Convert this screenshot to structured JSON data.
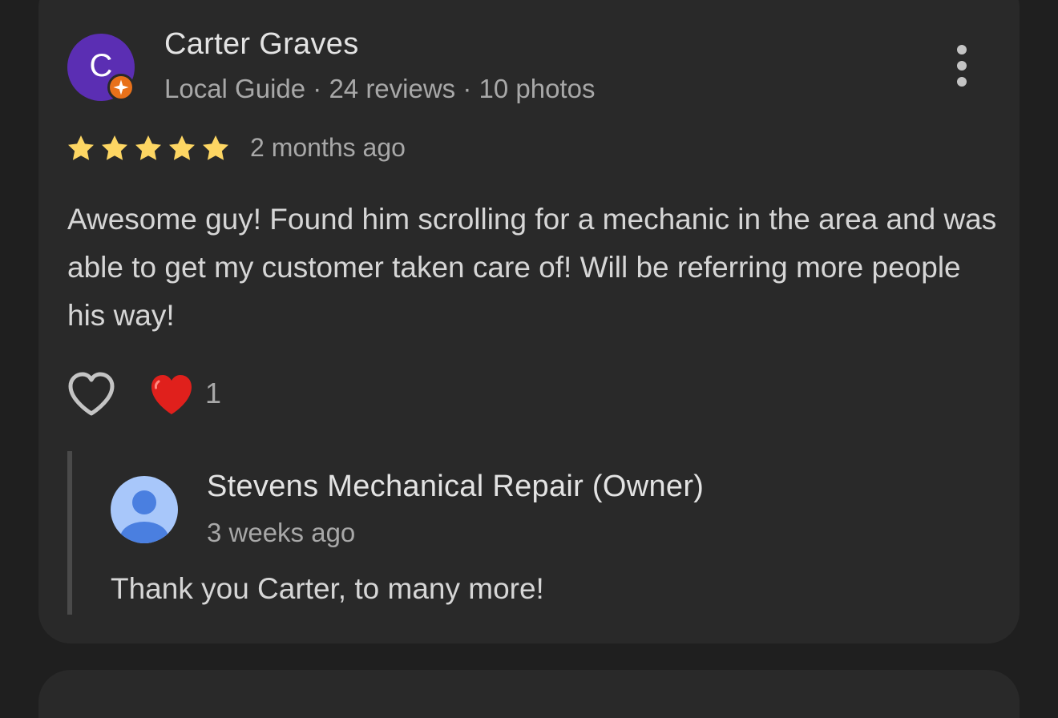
{
  "review": {
    "reviewer": {
      "initial": "C",
      "name": "Carter Graves",
      "meta": "Local Guide · 24 reviews · 10 photos",
      "avatar_color": "#5b2eb3",
      "badge_icon": "local-guide-star-icon",
      "badge_color": "#e8711a"
    },
    "rating": {
      "value": 5,
      "max": 5,
      "star_color": "#fdd663"
    },
    "time": "2 months ago",
    "text": "Awesome guy! Found him scrolling for a mechanic in the area and was able to get my customer taken care of! Will be referring more people his way!",
    "like_icon": "heart-outline-icon",
    "reaction": {
      "emoji": "❤️",
      "icon": "red-heart-icon",
      "count": "1"
    },
    "more_icon": "more-vert-icon"
  },
  "reply": {
    "owner_name": "Stevens Mechanical Repair (Owner)",
    "time": "3 weeks ago",
    "text": "Thank you Carter, to many more!",
    "avatar_icon": "default-person-avatar-icon",
    "avatar_color": "#a8c7fa"
  },
  "theme": {
    "background": "#1f1f1f",
    "card": "#292929",
    "primary_text": "#e3e3e3",
    "secondary_text": "#a8a8a8"
  }
}
